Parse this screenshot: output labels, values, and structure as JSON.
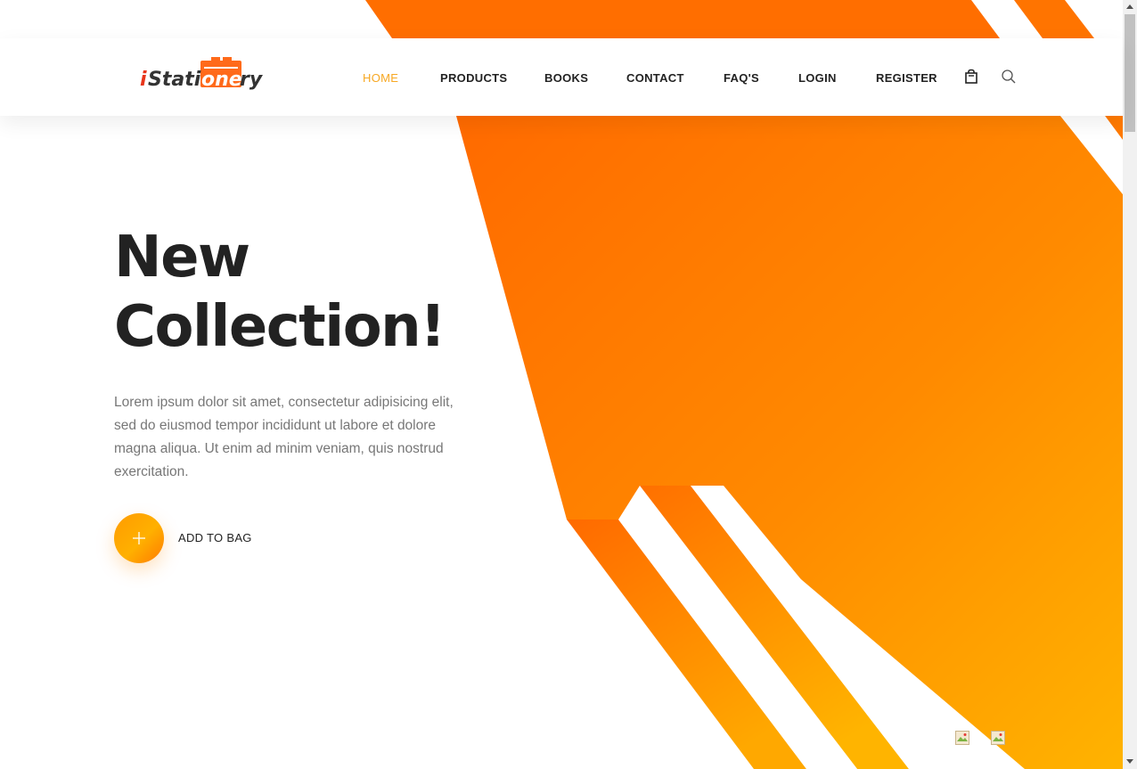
{
  "brand": {
    "logo_text_i": "i",
    "logo_text_stati": "Stati",
    "logo_text_one": "one",
    "logo_text_ry": "ry",
    "accent_color": "#f7a823",
    "orange_color": "#ff7000",
    "gold_color": "#ffb000"
  },
  "nav": {
    "items": [
      {
        "label": "HOME",
        "active": true
      },
      {
        "label": "PRODUCTS",
        "active": false
      },
      {
        "label": "BOOKS",
        "active": false
      },
      {
        "label": "CONTACT",
        "active": false
      },
      {
        "label": "FAQ'S",
        "active": false
      },
      {
        "label": "LOGIN",
        "active": false
      },
      {
        "label": "REGISTER",
        "active": false
      }
    ],
    "cart_icon": "shopping-bag-icon",
    "search_icon": "search-icon"
  },
  "hero": {
    "title_line1": "New",
    "title_line2": "Collection!",
    "description": "Lorem ipsum dolor sit amet, consectetur adipisicing elit, sed do eiusmod tempor incididunt ut labore et dolore magna aliqua. Ut enim ad minim veniam, quis nostrud exercitation.",
    "add_button_icon": "plus-icon",
    "add_label": "ADD TO BAG"
  },
  "slider": {
    "thumbnails": [
      "broken-image-icon",
      "broken-image-icon"
    ]
  }
}
